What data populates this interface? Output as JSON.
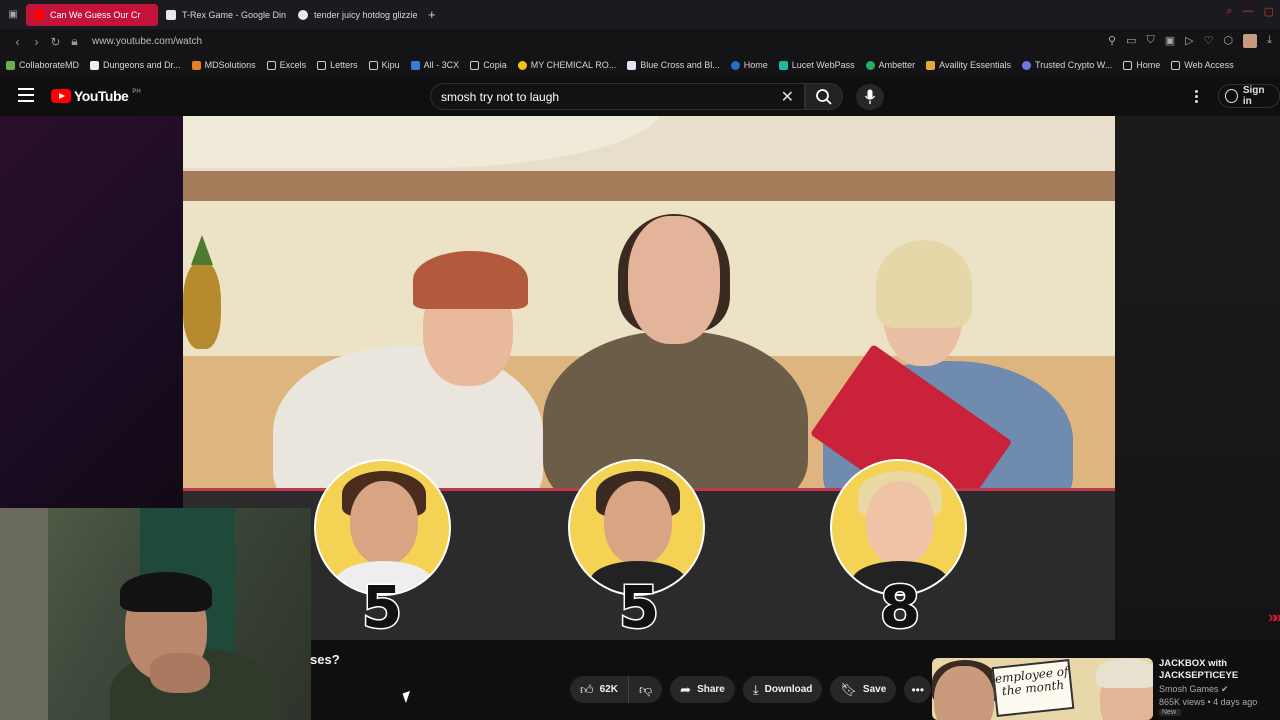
{
  "browser": {
    "tabs": [
      {
        "label": "Can We Guess Our Cr",
        "active": true
      },
      {
        "label": "T-Rex Game - Google Din",
        "active": false
      },
      {
        "label": "tender juicy hotdog glizzie",
        "active": false
      }
    ],
    "new_tab_label": "+",
    "url": "www.youtube.com/watch",
    "bookmarks": [
      "CollaborateMD",
      "Dungeons and Dr...",
      "MDSolutions",
      "Excels",
      "Letters",
      "Kipu",
      "All - 3CX",
      "Copia",
      "MY CHEMICAL RO...",
      "Blue Cross and Bl...",
      "Home",
      "Lucet WebPass",
      "Ambetter",
      "Availity Essentials",
      "Trusted Crypto W...",
      "Home",
      "Web Access"
    ]
  },
  "youtube": {
    "logo_text": "YouTube",
    "logo_region": "PH",
    "search_value": "smosh try not to laugh",
    "clear_glyph": "✕",
    "sign_in_label": "Sign in",
    "brand_color": "#ff0000"
  },
  "video": {
    "scores": [
      "5",
      "5",
      "8"
    ],
    "title_fragment": "ses?"
  },
  "actions": {
    "like_count": "62K",
    "share_label": "Share",
    "download_label": "Download",
    "save_label": "Save"
  },
  "recommendation": {
    "thumb_text": "employee of the month",
    "title": "JACKBOX with JACKSEPTICEYE",
    "channel": "Smosh Games",
    "meta": "865K views • 4 days ago",
    "badge": "New"
  }
}
